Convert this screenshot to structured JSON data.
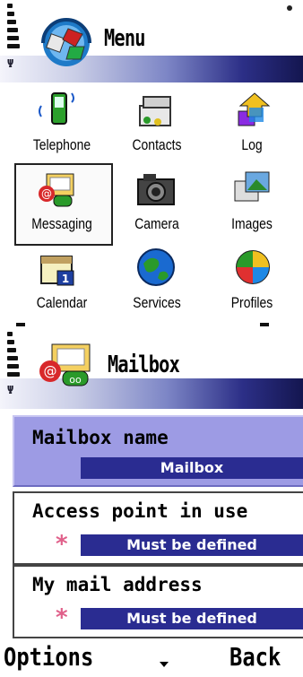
{
  "menu_screen": {
    "title": "Menu",
    "apps": [
      {
        "label": "Telephone",
        "icon": "telephone-icon"
      },
      {
        "label": "Contacts",
        "icon": "contacts-icon"
      },
      {
        "label": "Log",
        "icon": "log-icon"
      },
      {
        "label": "Messaging",
        "icon": "messaging-icon"
      },
      {
        "label": "Camera",
        "icon": "camera-icon"
      },
      {
        "label": "Images",
        "icon": "images-icon"
      },
      {
        "label": "Calendar",
        "icon": "calendar-icon"
      },
      {
        "label": "Services",
        "icon": "services-icon"
      },
      {
        "label": "Profiles",
        "icon": "profiles-icon"
      }
    ],
    "selected_app": "Messaging"
  },
  "mailbox_screen": {
    "title": "Mailbox",
    "fields": [
      {
        "label": "Mailbox name",
        "value": "Mailbox",
        "required": false
      },
      {
        "label": "Access point in use",
        "value": "Must be defined",
        "required": true
      },
      {
        "label": "My mail address",
        "value": "Must be defined",
        "required": true
      }
    ],
    "softkeys": {
      "left": "Options",
      "right": "Back"
    },
    "colors": {
      "selection": "#9d9be4",
      "value_bar": "#2a2c91",
      "required_star": "#e0608a"
    }
  }
}
